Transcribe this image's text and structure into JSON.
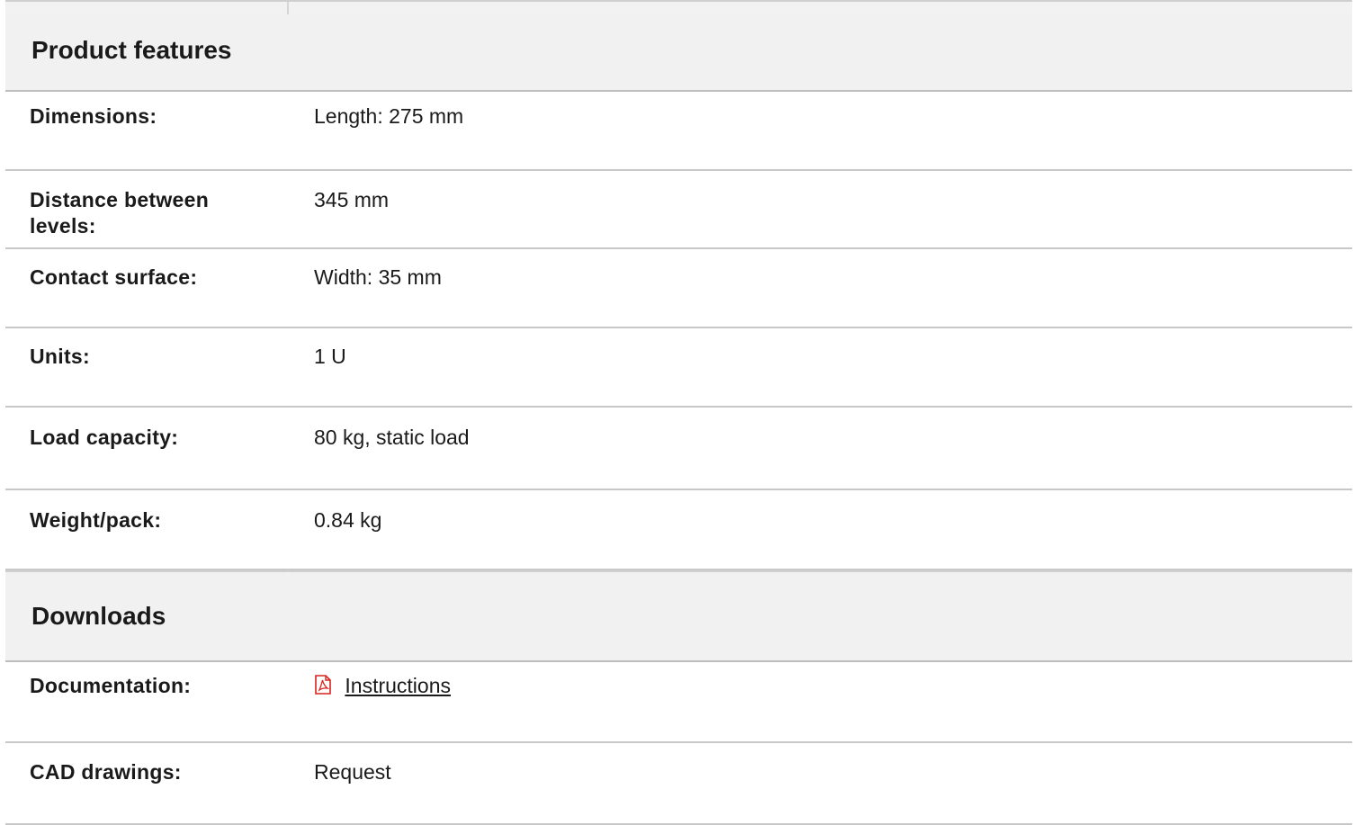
{
  "features": {
    "title": "Product features",
    "rows": [
      {
        "label": "Dimensions:",
        "value": "Length: 275 mm"
      },
      {
        "label": "Distance between levels:",
        "value": "345 mm"
      },
      {
        "label": "Contact surface:",
        "value": "Width: 35 mm"
      },
      {
        "label": "Units:",
        "value": "1 U"
      },
      {
        "label": "Load capacity:",
        "value": "80 kg, static load"
      },
      {
        "label": "Weight/pack:",
        "value": "0.84 kg"
      }
    ]
  },
  "downloads": {
    "title": "Downloads",
    "rows": [
      {
        "label": "Documentation:",
        "link": "Instructions",
        "icon": "pdf-icon"
      },
      {
        "label": "CAD drawings:",
        "value": "Request"
      }
    ]
  },
  "colors": {
    "header_bg": "#f1f1f2",
    "pdf_red": "#d9231d"
  }
}
